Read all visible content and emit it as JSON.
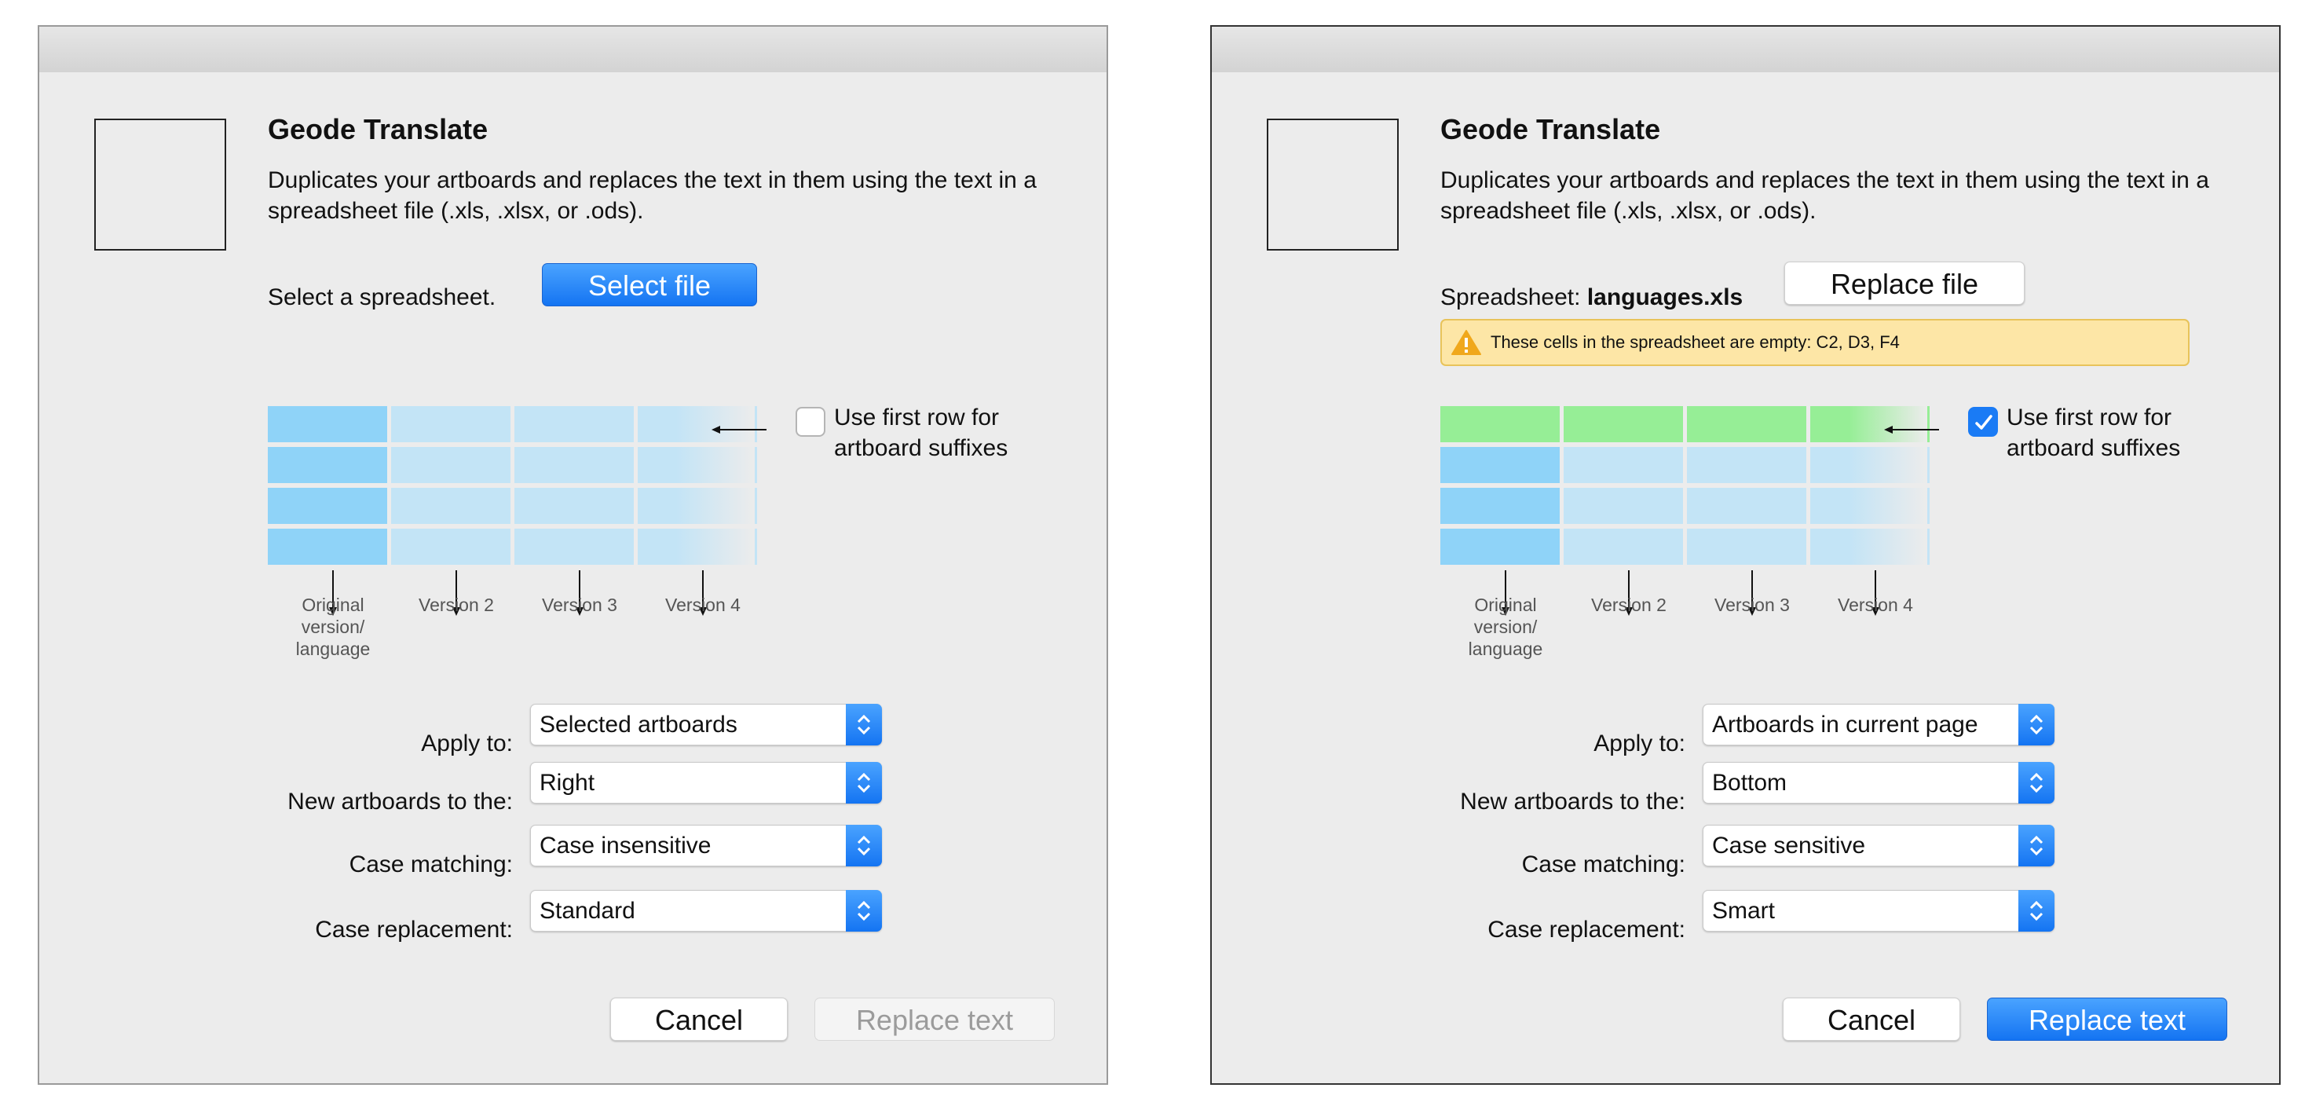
{
  "dialogs": [
    {
      "title": "Geode Translate",
      "description": "Duplicates your artboards and replaces the text in them using the text in a spreadsheet file (.xls, .xlsx, or .ods).",
      "spreadsheet_prompt": "Select a spreadsheet.",
      "select_button": "Select file",
      "first_row_checkbox": {
        "label": "Use first row for artboard suffixes",
        "checked": false
      },
      "column_labels": [
        "Original version/ language",
        "Version 2",
        "Version 3",
        "Version 4"
      ],
      "form": {
        "apply_to": {
          "label": "Apply to:",
          "value": "Selected artboards"
        },
        "new_artboards": {
          "label": "New artboards to the:",
          "value": "Right"
        },
        "case_matching": {
          "label": "Case matching:",
          "value": "Case insensitive"
        },
        "case_replacement": {
          "label": "Case replacement:",
          "value": "Standard"
        }
      },
      "cancel_button": "Cancel",
      "replace_button": "Replace text",
      "replace_enabled": false
    },
    {
      "title": "Geode Translate",
      "description": "Duplicates your artboards and replaces the text in them using the text in a spreadsheet file (.xls, .xlsx, or .ods).",
      "spreadsheet_label": "Spreadsheet:",
      "spreadsheet_file": "languages.xls",
      "replace_file_button": "Replace file",
      "warning": "These cells in the spreadsheet are empty: C2, D3, F4",
      "first_row_checkbox": {
        "label": "Use first row for artboard suffixes",
        "checked": true
      },
      "column_labels": [
        "Original version/ language",
        "Version 2",
        "Version 3",
        "Version 4"
      ],
      "form": {
        "apply_to": {
          "label": "Apply to:",
          "value": "Artboards in current page"
        },
        "new_artboards": {
          "label": "New artboards to the:",
          "value": "Bottom"
        },
        "case_matching": {
          "label": "Case matching:",
          "value": "Case sensitive"
        },
        "case_replacement": {
          "label": "Case replacement:",
          "value": "Smart"
        }
      },
      "cancel_button": "Cancel",
      "replace_button": "Replace text",
      "replace_enabled": true
    }
  ],
  "colors": {
    "accent_blue": "#1474f2",
    "grid_first_column": "#8fd3f8",
    "grid_cell": "#c3e4f6",
    "grid_header_green": "#96ee96",
    "warning_bg": "#fde6a6",
    "warning_icon": "#f0a81c"
  },
  "icons": [
    "chevron-updown-icon",
    "checkmark-icon",
    "warning-triangle-icon",
    "arrow-left-icon",
    "arrow-down-icon"
  ]
}
